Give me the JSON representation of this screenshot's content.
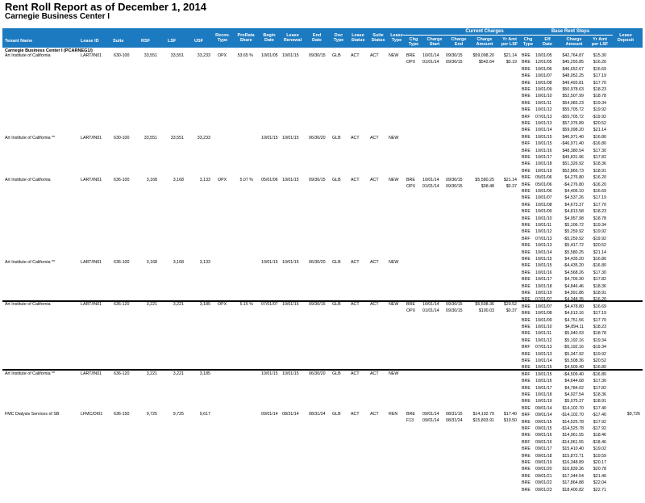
{
  "report": {
    "title": "Rent Roll Report as of December 1, 2014",
    "subtitle": "Carnegie Business Center I",
    "property": "Carnegie Business Center I (PCARNEG1/)"
  },
  "headers": {
    "current_charges": "Current Charges",
    "base_rent_steps": "Base Rent Steps",
    "tenant_name": "Tenant Name",
    "lease_id": "Lease ID",
    "suite": "Suite",
    "rsf": "RSF",
    "lsf": "LSF",
    "usf": "USF",
    "recov_type": "Recov. Type",
    "prorata_share": "ProRata Share",
    "begin_date": "Begin Date",
    "lease_renewal": "Lease Renewal",
    "end_date": "End Date",
    "doc_type": "Doc Type",
    "lease_status": "Lease Status",
    "suite_status": "Suite Status",
    "lease_type": "Lease Type",
    "chg_type": "Chg Type",
    "charge_start": "Charge Start",
    "charge_end": "Charge End",
    "charge_amount": "Charge Amount",
    "yr_amt_lsf": "Yr Amt per LSF",
    "step_chg_type": "Chg Type",
    "eff_date": "Eff Date",
    "step_charge_amount": "Charge Amount",
    "step_yr_amt": "Yr Amt per LSF",
    "lease_deposit": "Lease Deposit"
  },
  "leases": [
    {
      "tenant": "Art Institute of California",
      "lease_id": "LART/IN01",
      "suite": "630-100",
      "rsf": "33,551",
      "lsf": "33,551",
      "usf": "33,233",
      "recov": "OPX",
      "prorata": "53.65 %",
      "begin": "10/01/05",
      "renewal": "10/01/15",
      "end": "09/30/15",
      "doc": "GLB",
      "lstatus": "ACT",
      "sstatus": "ACT",
      "ltype": "NEW",
      "deposit": "",
      "charges": [
        [
          "BRE",
          "10/01/14",
          "09/30/15",
          "$59,098.20",
          "$21.14"
        ],
        [
          "OPX",
          "01/01/14",
          "09/30/15",
          "$542.64",
          "$0.19"
        ]
      ]
    },
    {
      "tenant": "Art Institute of California **",
      "lease_id": "LART/IN01",
      "suite": "630-100",
      "rsf": "33,551",
      "lsf": "33,551",
      "usf": "33,233",
      "recov": "",
      "prorata": "",
      "begin": "10/01/15",
      "renewal": "10/01/15",
      "end": "06/30/20",
      "doc": "GLB",
      "lstatus": "ACT",
      "sstatus": "ACT",
      "ltype": "NEW",
      "deposit": "",
      "charges": []
    },
    {
      "tenant": "Art Institute of California",
      "lease_id": "LART/IN01",
      "suite": "636-100",
      "rsf": "3,168",
      "lsf": "3,168",
      "usf": "3,133",
      "recov": "OPX",
      "prorata": "5.07 %",
      "begin": "05/01/06",
      "renewal": "10/01/15",
      "end": "09/30/15",
      "doc": "GLB",
      "lstatus": "ACT",
      "sstatus": "ACT",
      "ltype": "NEW",
      "deposit": "",
      "charges": [
        [
          "BRE",
          "10/01/14",
          "09/30/15",
          "$5,580.25",
          "$21.14"
        ],
        [
          "OPX",
          "01/01/14",
          "09/30/15",
          "$98.48",
          "$0.37"
        ]
      ]
    },
    {
      "tenant": "Art Institute of California **",
      "lease_id": "LART/IN01",
      "suite": "636-100",
      "rsf": "3,168",
      "lsf": "3,168",
      "usf": "3,133",
      "recov": "",
      "prorata": "",
      "begin": "10/01/15",
      "renewal": "10/01/15",
      "end": "06/30/20",
      "doc": "GLB",
      "lstatus": "ACT",
      "sstatus": "ACT",
      "ltype": "NEW",
      "deposit": "",
      "charges": []
    },
    {
      "tenant": "Art Institute of California",
      "lease_id": "LART/IN01",
      "suite": "636-120",
      "rsf": "3,221",
      "lsf": "3,221",
      "usf": "3,185",
      "recov": "OPX",
      "prorata": "5.15 %",
      "begin": "07/01/07",
      "renewal": "10/01/15",
      "end": "09/30/15",
      "doc": "GLB",
      "lstatus": "ACT",
      "sstatus": "ACT",
      "ltype": "NEW",
      "deposit": "",
      "charges": [
        [
          "BRE",
          "10/01/14",
          "09/30/15",
          "$5,508.36",
          "$20.52"
        ],
        [
          "OPX",
          "01/01/14",
          "09/30/15",
          "$100.03",
          "$0.37"
        ]
      ]
    },
    {
      "tenant": "Art Institute of California **",
      "lease_id": "LART/IN01",
      "suite": "636-120",
      "rsf": "3,221",
      "lsf": "3,221",
      "usf": "3,185",
      "recov": "",
      "prorata": "",
      "begin": "10/01/15",
      "renewal": "10/01/15",
      "end": "06/30/20",
      "doc": "GLB",
      "lstatus": "ACT",
      "sstatus": "ACT",
      "ltype": "NEW",
      "deposit": "",
      "charges": []
    },
    {
      "tenant": "FMC Dialysis Services of SB",
      "lease_id": "LFMC/DI01",
      "suite": "636-150",
      "rsf": "9,725",
      "lsf": "9,725",
      "usf": "9,617",
      "recov": "",
      "prorata": "",
      "begin": "09/01/14",
      "renewal": "08/31/14",
      "end": "08/31/24",
      "doc": "GLB",
      "lstatus": "ACT",
      "sstatus": "ACT",
      "ltype": "REN",
      "deposit": "$9,726",
      "charges": [
        [
          "BRE",
          "09/01/14",
          "08/31/15",
          "$14,102.70",
          "$17.40"
        ],
        [
          "F13",
          "09/01/14",
          "08/31/24",
          "$15,803.91",
          "$19.50"
        ]
      ]
    }
  ],
  "steps": [
    [
      "BRE",
      "10/01/05",
      "$42,764.87",
      "$15.30"
    ],
    [
      "BRE",
      "12/01/05",
      "$45,293.85",
      "$16.20"
    ],
    [
      "BRE",
      "10/01/06",
      "$46,652.67",
      "$16.69"
    ],
    [
      "BRE",
      "10/01/07",
      "$48,052.25",
      "$17.19"
    ],
    [
      "BRE",
      "10/01/08",
      "$49,493.81",
      "$17.70"
    ],
    [
      "BRE",
      "10/01/09",
      "$50,978.63",
      "$18.23"
    ],
    [
      "BRE",
      "10/01/10",
      "$52,507.99",
      "$18.78"
    ],
    [
      "BRE",
      "10/01/11",
      "$54,083.23",
      "$19.34"
    ],
    [
      "BRE",
      "10/01/12",
      "$55,705.72",
      "$19.92"
    ],
    [
      "BRF",
      "07/01/13",
      "-$55,705.72",
      "-$19.92"
    ],
    [
      "BRE",
      "10/01/13",
      "$57,376.89",
      "$20.52"
    ],
    [
      "BRE",
      "10/01/14",
      "$59,098.20",
      "$21.14"
    ],
    [
      "BRE",
      "10/01/15",
      "$46,971.40",
      "$16.80"
    ],
    [
      "BRF",
      "10/01/15",
      "-$46,971.40",
      "-$16.80"
    ],
    [
      "BRE",
      "10/01/16",
      "$48,380.54",
      "$17.30"
    ],
    [
      "BRE",
      "10/01/17",
      "$49,831.96",
      "$17.82"
    ],
    [
      "BRE",
      "10/01/18",
      "$51,326.92",
      "$18.36"
    ],
    [
      "BRE",
      "10/01/19",
      "$52,866.73",
      "$18.91"
    ],
    [
      "BRE",
      "05/01/06",
      "$4,276.80",
      "$16.20"
    ],
    [
      "BRE",
      "05/01/06",
      "-$4,276.80",
      "-$16.20"
    ],
    [
      "BRE",
      "10/01/06",
      "$4,405.10",
      "$16.69"
    ],
    [
      "BRE",
      "10/01/07",
      "$4,537.26",
      "$17.19"
    ],
    [
      "BRE",
      "10/01/08",
      "$4,673.37",
      "$17.70"
    ],
    [
      "BRE",
      "10/01/09",
      "$4,813.58",
      "$18.23"
    ],
    [
      "BRE",
      "10/01/10",
      "$4,957.98",
      "$18.78"
    ],
    [
      "BRE",
      "10/01/11",
      "$5,106.72",
      "$19.34"
    ],
    [
      "BRE",
      "10/01/12",
      "$5,259.92",
      "$19.92"
    ],
    [
      "BRF",
      "07/01/13",
      "-$5,259.92",
      "-$19.92"
    ],
    [
      "BRE",
      "10/01/13",
      "$5,417.72",
      "$20.52"
    ],
    [
      "BRE",
      "10/01/14",
      "$5,580.25",
      "$21.14"
    ],
    [
      "BRE",
      "10/01/15",
      "$4,435.20",
      "$16.80"
    ],
    [
      "BRE",
      "10/01/15",
      "-$4,435.20",
      "-$16.80"
    ],
    [
      "BRE",
      "10/01/16",
      "$4,568.26",
      "$17.30"
    ],
    [
      "BRE",
      "10/01/17",
      "$4,705.30",
      "$17.82"
    ],
    [
      "BRE",
      "10/01/18",
      "$4,846.46",
      "$18.36"
    ],
    [
      "BRE",
      "10/01/19",
      "$4,991.86",
      "$18.91"
    ],
    [
      "BRE",
      "07/01/07",
      "$4,348.35",
      "$16.20"
    ],
    [
      "BRE",
      "10/01/07",
      "$4,478.80",
      "$16.69"
    ],
    [
      "BRE",
      "10/01/08",
      "$4,613.16",
      "$17.19"
    ],
    [
      "BRE",
      "10/01/09",
      "$4,751.56",
      "$17.70"
    ],
    [
      "BRE",
      "10/01/10",
      "$4,894.11",
      "$18.23"
    ],
    [
      "BRE",
      "10/01/11",
      "$5,040.93",
      "$18.78"
    ],
    [
      "BRE",
      "10/01/12",
      "$5,192.16",
      "$19.34"
    ],
    [
      "BRF",
      "07/01/13",
      "-$5,192.16",
      "-$19.34"
    ],
    [
      "BRE",
      "10/01/13",
      "$5,347.92",
      "$19.92"
    ],
    [
      "BRE",
      "10/01/14",
      "$5,508.36",
      "$20.52"
    ],
    [
      "BRE",
      "10/01/15",
      "$4,509.40",
      "$16.80"
    ],
    [
      "BRF",
      "10/01/15",
      "-$4,509.40",
      "-$16.80"
    ],
    [
      "BRE",
      "10/01/16",
      "$4,644.68",
      "$17.30"
    ],
    [
      "BRE",
      "10/01/17",
      "$4,784.02",
      "$17.82"
    ],
    [
      "BRE",
      "10/01/18",
      "$4,927.54",
      "$18.36"
    ],
    [
      "BRE",
      "10/01/19",
      "$5,075.37",
      "$18.91"
    ],
    [
      "BRE",
      "09/01/14",
      "$14,102.70",
      "$17.40"
    ],
    [
      "BRF",
      "09/01/14",
      "-$14,102.70",
      "-$17.40"
    ],
    [
      "BRE",
      "09/01/15",
      "$14,525.78",
      "$17.92"
    ],
    [
      "BRF",
      "09/01/15",
      "-$14,525.78",
      "-$17.92"
    ],
    [
      "BRE",
      "09/01/16",
      "$14,961.55",
      "$18.46"
    ],
    [
      "BRF",
      "09/01/16",
      "-$14,961.55",
      "-$18.46"
    ],
    [
      "BRE",
      "09/01/17",
      "$15,410.40",
      "$19.02"
    ],
    [
      "BRE",
      "09/01/18",
      "$15,872.71",
      "$19.59"
    ],
    [
      "BRE",
      "09/01/19",
      "$16,348.89",
      "$20.17"
    ],
    [
      "BRE",
      "09/01/20",
      "$16,839.36",
      "$20.78"
    ],
    [
      "BRE",
      "09/01/21",
      "$17,344.54",
      "$21.40"
    ],
    [
      "BRE",
      "09/01/22",
      "$17,864.88",
      "$22.04"
    ],
    [
      "BRE",
      "09/01/23",
      "$18,400.82",
      "$22.71"
    ]
  ]
}
